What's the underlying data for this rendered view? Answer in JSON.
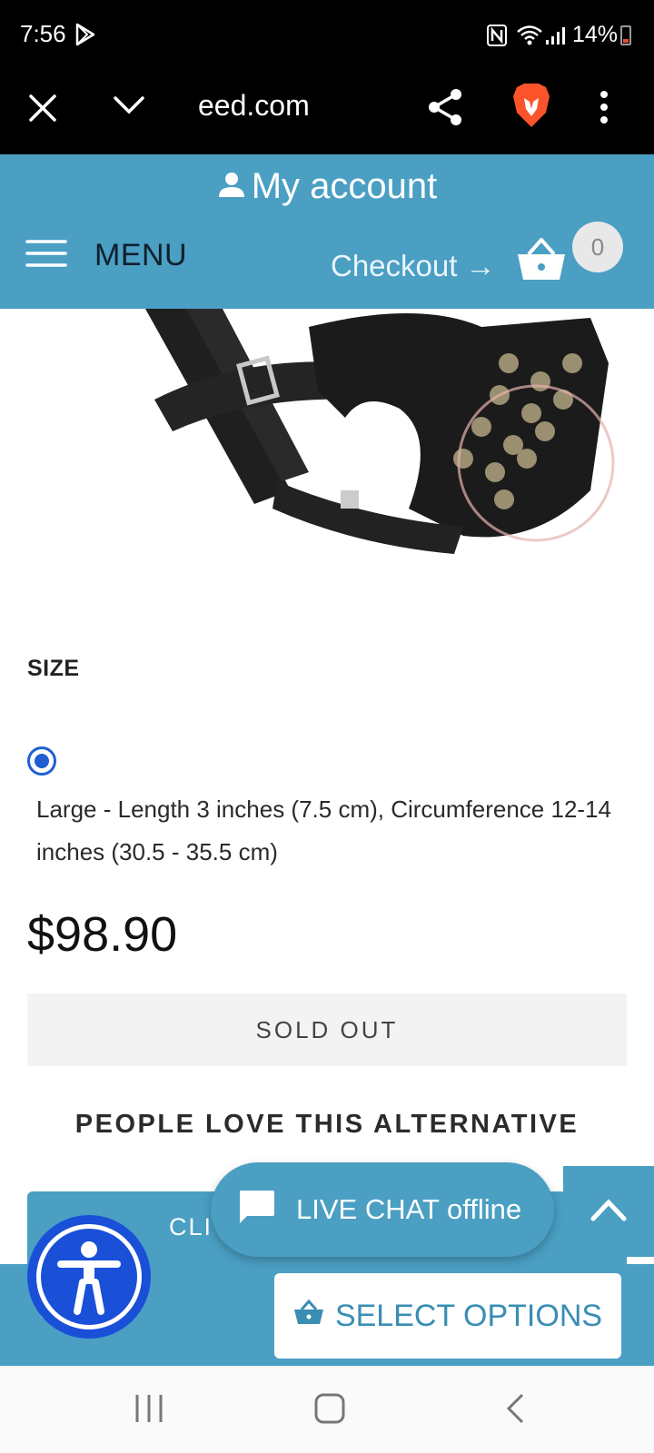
{
  "status_bar": {
    "time": "7:56",
    "battery": "14%",
    "colors": {
      "battery_low": "#e24b3b"
    }
  },
  "browser": {
    "url": "eed.com"
  },
  "header": {
    "account_label": "My account",
    "menu_label": "MENU",
    "checkout_label": "Checkout →",
    "cart_count": "0",
    "colors": {
      "accent": "#4a9fc3"
    }
  },
  "product": {
    "size_label": "SIZE",
    "size_option": "Large - Length 3 inches (7.5 cm), Circumference 12-14 inches (30.5 - 35.5 cm)",
    "price": "$98.90",
    "sold_out_label": "SOLD OUT",
    "image_icon": "leather-muzzle-image"
  },
  "alternatives": {
    "title": "PEOPLE LOVE THIS ALTERNATIVE",
    "cta_partial": "CLI"
  },
  "chat": {
    "label": "LIVE CHAT offline"
  },
  "bottom": {
    "price_partial": "$",
    "select_label": "SELECT OPTIONS"
  }
}
